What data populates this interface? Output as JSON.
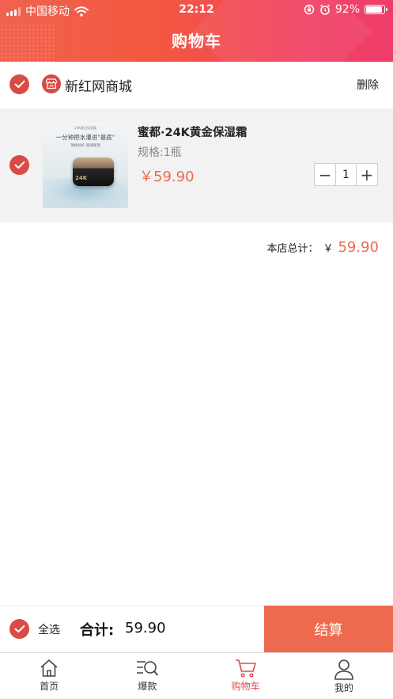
{
  "status_bar": {
    "carrier": "中国移动",
    "time": "22:12",
    "battery": "92%",
    "battery_level": 0.92
  },
  "header": {
    "title": "购物车"
  },
  "store": {
    "name": "新红网商城",
    "delete_label": "删除",
    "checked": true
  },
  "product": {
    "checked": true,
    "name": "蜜都·24K黄金保湿霜",
    "spec": "规格:1瓶",
    "price": "￥59.90",
    "quantity": "1",
    "minus": "−",
    "plus": "+",
    "image": {
      "top_text": "24K黄金保湿霜",
      "headline": "一分钟把水灌进\"基底\"",
      "subline": "持续补护 润泽保湿",
      "jar_text": "24K"
    }
  },
  "store_total": {
    "label": "本店总计：",
    "currency": "￥",
    "amount": "59.90"
  },
  "checkout": {
    "select_all_label": "全选",
    "total_label": "合计:",
    "total_value": "59.90",
    "pay_label": "结算"
  },
  "tabbar": {
    "items": [
      {
        "label": "首页",
        "icon": "home-icon",
        "active": false
      },
      {
        "label": "爆款",
        "icon": "search-list-icon",
        "active": false
      },
      {
        "label": "购物车",
        "icon": "cart-icon",
        "active": true
      },
      {
        "label": "我的",
        "icon": "user-icon",
        "active": false
      }
    ]
  },
  "colors": {
    "accent": "#ee6a4e",
    "check": "#d94b45",
    "header_start": "#f0634f",
    "header_end": "#ee3d6a",
    "active_tab": "#e24a4a"
  }
}
